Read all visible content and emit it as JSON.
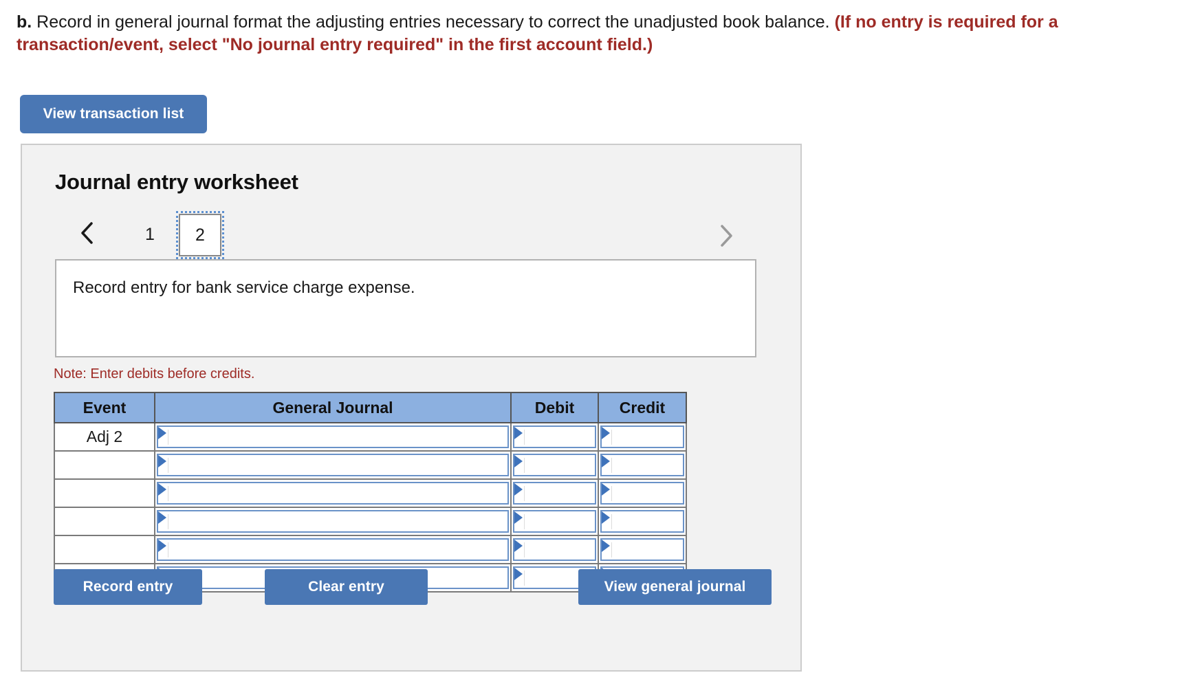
{
  "prompt": {
    "label": "b.",
    "text": " Record in general journal format the adjusting entries necessary to correct the unadjusted book balance. ",
    "hint": "(If no entry is required for a transaction/event, select \"No journal entry required\" in the first account field.)"
  },
  "toolbar": {
    "view_transaction_list_label": "View transaction list"
  },
  "worksheet": {
    "title": "Journal entry worksheet",
    "pager": {
      "prev_icon": "chevron-left-icon",
      "next_icon": "chevron-right-icon",
      "pages": [
        "1",
        "2"
      ],
      "selected_page": "2"
    },
    "scenario_text": "Record entry for bank service charge expense.",
    "note": "Note: Enter debits before credits.",
    "table": {
      "columns": [
        "Event",
        "General Journal",
        "Debit",
        "Credit"
      ],
      "rows": [
        {
          "event": "Adj 2",
          "journal": "",
          "debit": "",
          "credit": ""
        },
        {
          "event": "",
          "journal": "",
          "debit": "",
          "credit": ""
        },
        {
          "event": "",
          "journal": "",
          "debit": "",
          "credit": ""
        },
        {
          "event": "",
          "journal": "",
          "debit": "",
          "credit": ""
        },
        {
          "event": "",
          "journal": "",
          "debit": "",
          "credit": ""
        },
        {
          "event": "",
          "journal": "",
          "debit": "",
          "credit": ""
        }
      ]
    },
    "footer": {
      "record_entry_label": "Record entry",
      "clear_entry_label": "Clear entry",
      "view_general_journal_label": "View general journal"
    }
  },
  "colors": {
    "button_blue": "#4a77b4",
    "table_header_blue": "#8cb0e0",
    "field_border_blue": "#6a92c8",
    "dropdown_triangle_blue": "#3f73bb",
    "hint_red": "#9e2b26",
    "panel_background": "#f2f2f2",
    "panel_border": "#cccccc"
  }
}
